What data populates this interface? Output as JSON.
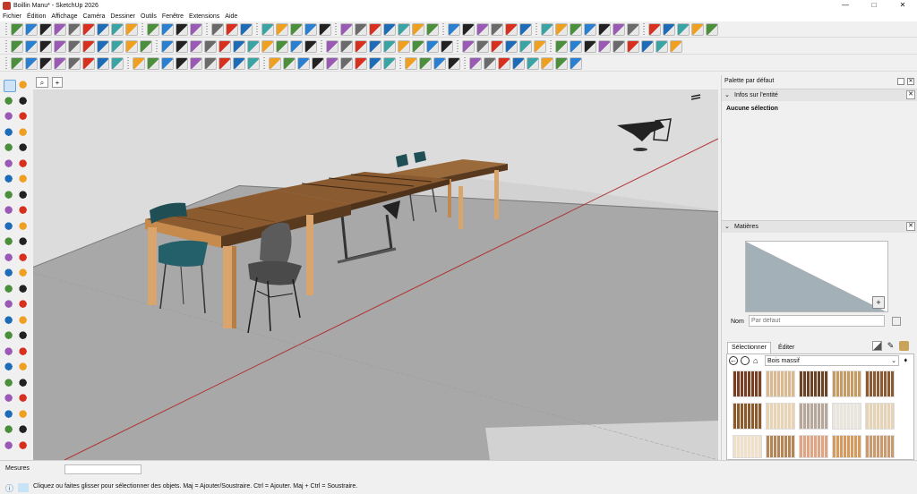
{
  "window": {
    "title": "Boillin Manu* - SketchUp 2026",
    "controls": {
      "minimize": "—",
      "maximize": "□",
      "close": "✕"
    }
  },
  "menu": [
    "Fichier",
    "Édition",
    "Affichage",
    "Caméra",
    "Dessiner",
    "Outils",
    "Fenêtre",
    "Extensions",
    "Aide"
  ],
  "viewport_tabs": {
    "search_glyph": "⌕",
    "add_glyph": "+"
  },
  "tray": {
    "title": "Palette par défaut",
    "entity_info": {
      "header": "Infos sur l'entité",
      "body": "Aucune sélection"
    },
    "materials": {
      "header": "Matières",
      "name_label": "Nom",
      "name_placeholder": "Par défaut",
      "tabs": [
        "Sélectionner",
        "Éditer"
      ],
      "collection": "Bois massif",
      "swatch_colors": [
        "#7a3e22",
        "#d9b98e",
        "#6b4427",
        "#c59b62",
        "#8a5a33",
        "#8b5a2b",
        "#e8d4b2",
        "#b7a79a",
        "#e9e4dc",
        "#e6d3b4",
        "#f0e0c8",
        "#b58655",
        "#e0a483",
        "#d59a5c",
        "#c89a6d"
      ]
    }
  },
  "status": {
    "measure_label": "Mesures",
    "hint": "Cliquez ou faites glisser pour sélectionner des objets. Maj = Ajouter/Soustraire. Ctrl = Ajouter. Maj + Ctrl = Soustraire."
  }
}
